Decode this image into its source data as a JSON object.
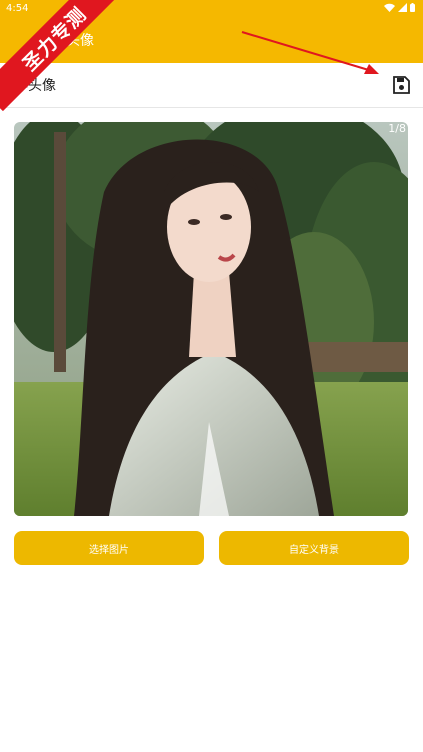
{
  "status_bar": {
    "time": "4:54"
  },
  "app_bar": {
    "title": "作头像"
  },
  "toolbar": {
    "title": "作头像"
  },
  "image_view": {
    "counter": "1/8"
  },
  "buttons": {
    "select_image": "选择图片",
    "custom_background": "自定义背景"
  },
  "watermark": {
    "text": "圣力专测"
  },
  "colors": {
    "accent": "#F5B800",
    "button": "#EDB800",
    "annotation_arrow": "#E0171F"
  }
}
